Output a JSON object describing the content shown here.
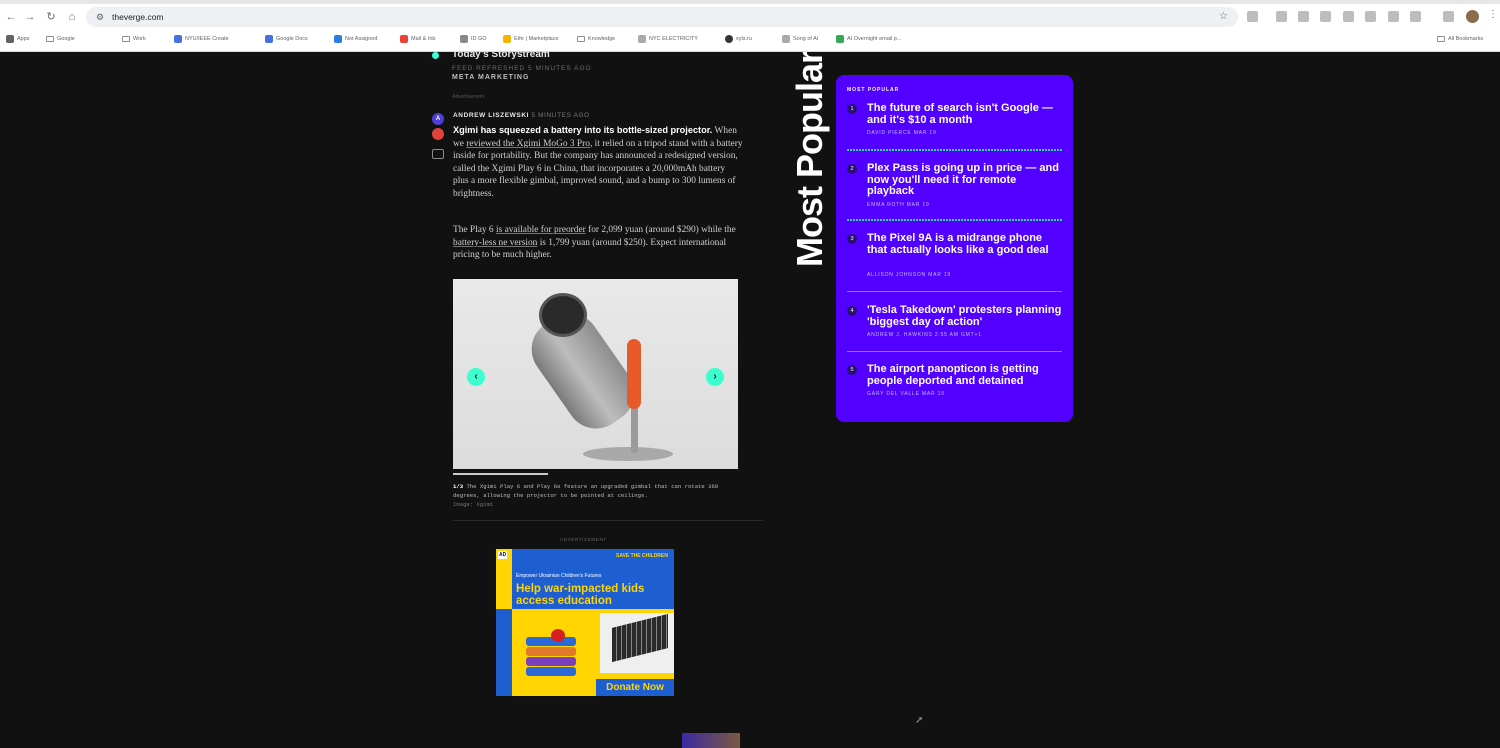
{
  "browser": {
    "url": "theverge.com",
    "bookmarks": [
      {
        "label": "Apps",
        "kind": "apps"
      },
      {
        "label": "Google",
        "kind": "folder"
      },
      {
        "label": "Work",
        "kind": "folder"
      },
      {
        "label": "NYU/IEEE Create",
        "kind": "site"
      },
      {
        "label": "Google Docs",
        "kind": "site"
      },
      {
        "label": "Not Assigned",
        "kind": "site"
      },
      {
        "label": "Mail & Inb",
        "kind": "site"
      },
      {
        "label": "ID GO",
        "kind": "site"
      },
      {
        "label": "Ethr | Marketplace",
        "kind": "site"
      },
      {
        "label": "Knowledge",
        "kind": "folder"
      },
      {
        "label": "NYC ELECTRICITY",
        "kind": "site"
      },
      {
        "label": "xyls.ru",
        "kind": "site"
      },
      {
        "label": "Song of AI",
        "kind": "site"
      },
      {
        "label": "AI Overnight email p...",
        "kind": "site"
      }
    ],
    "all_bookmarks_label": "All Bookmarks"
  },
  "storystream": {
    "title": "Today's Storystream",
    "meta": "FEED REFRESHED 5 MINUTES AGO",
    "tag": "META MARKETING",
    "sponsored": "Advertisement"
  },
  "post": {
    "author": "ANDREW LISZEWSKI",
    "time": "5 MINUTES AGO",
    "author_initial": "A",
    "lead": "Xgimi has squeezed a battery into its bottle-sized projector.",
    "p1_a": " When we ",
    "p1_link1": "reviewed the Xgimi MoGo 3 Pro",
    "p1_b": ", it relied on a tripod stand with a battery inside for portability. But the company has announced a redesigned version, called the Xgimi Play 6 in China, that incorporates a 20,000mAh battery plus a more flexible gimbal, improved sound, and a bump to 300 lumens of brightness.",
    "p2_a": "The Play 6 ",
    "p2_link1": "is available for preorder",
    "p2_b": " for 2,099 yuan (around $290) while the ",
    "p2_link2": "battery-less ne version",
    "p2_c": " is 1,799 yuan (around $250). Expect international pricing to be much higher.",
    "gallery": {
      "prev": "‹",
      "next": "›"
    },
    "caption_index": "1/3",
    "caption_text": "The Xgimi Play 6 and Play 6e feature an upgraded gimbal that can rotate 360 degrees, allowing the projector to be pointed at ceilings.",
    "caption_credit": "Image: Xgimi"
  },
  "ad": {
    "label": "ADVERTISEMENT",
    "badge": "AD",
    "org": "SAVE THE CHILDREN",
    "sub": "Empower Ukrainian Children's Futures",
    "headline": "Help war-impacted kids access education",
    "cta": "Donate Now"
  },
  "most_popular": {
    "vertical_title": "Most Popular",
    "label": "MOST POPULAR",
    "items": [
      {
        "num": "1",
        "title": "The future of search isn't Google — and it's $10 a month",
        "meta": "DAVID PIERCE  MAR 19"
      },
      {
        "num": "2",
        "title": "Plex Pass is going up in price — and now you'll need it for remote playback",
        "meta": "EMMA ROTH  MAR 19"
      },
      {
        "num": "3",
        "title": "The Pixel 9A is a midrange phone that actually looks like a good deal",
        "meta": "ALLISON JOHNSON  MAR 19"
      },
      {
        "num": "4",
        "title": "'Tesla Takedown' protesters planning 'biggest day of action'",
        "meta": "ANDREW J. HAWKINS  2:55 AM GMT+1"
      },
      {
        "num": "5",
        "title": "The airport panopticon is getting people deported and detained",
        "meta": "GARY DEL VALLE  MAR 19"
      }
    ]
  }
}
